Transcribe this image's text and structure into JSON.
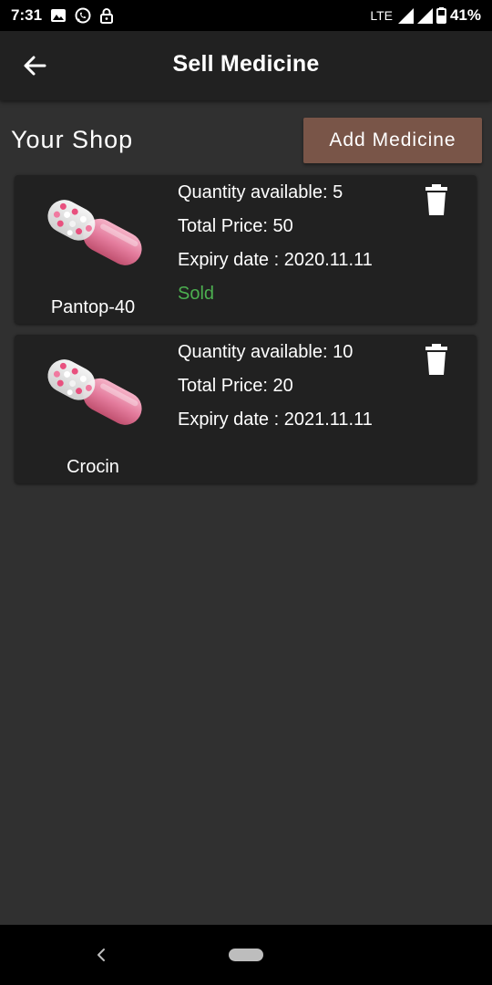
{
  "status_bar": {
    "time": "7:31",
    "network": "LTE",
    "battery": "41%"
  },
  "app_bar": {
    "title": "Sell Medicine"
  },
  "shop": {
    "title": "Your Shop",
    "add_button_label": "Add Medicine"
  },
  "medicines": [
    {
      "name": "Pantop-40",
      "quantity_line": "Quantity available: 5",
      "price_line": "Total Price: 50",
      "expiry_line": "Expiry date : 2020.11.11",
      "status": "Sold"
    },
    {
      "name": "Crocin",
      "quantity_line": "Quantity available: 10",
      "price_line": "Total Price: 20",
      "expiry_line": "Expiry date : 2021.11.11",
      "status": ""
    }
  ],
  "colors": {
    "background": "#303030",
    "app_bar": "#212121",
    "card": "#212121",
    "add_button": "#795548",
    "sold_status": "#4caf50",
    "pill_pink": "#e57c9e"
  }
}
